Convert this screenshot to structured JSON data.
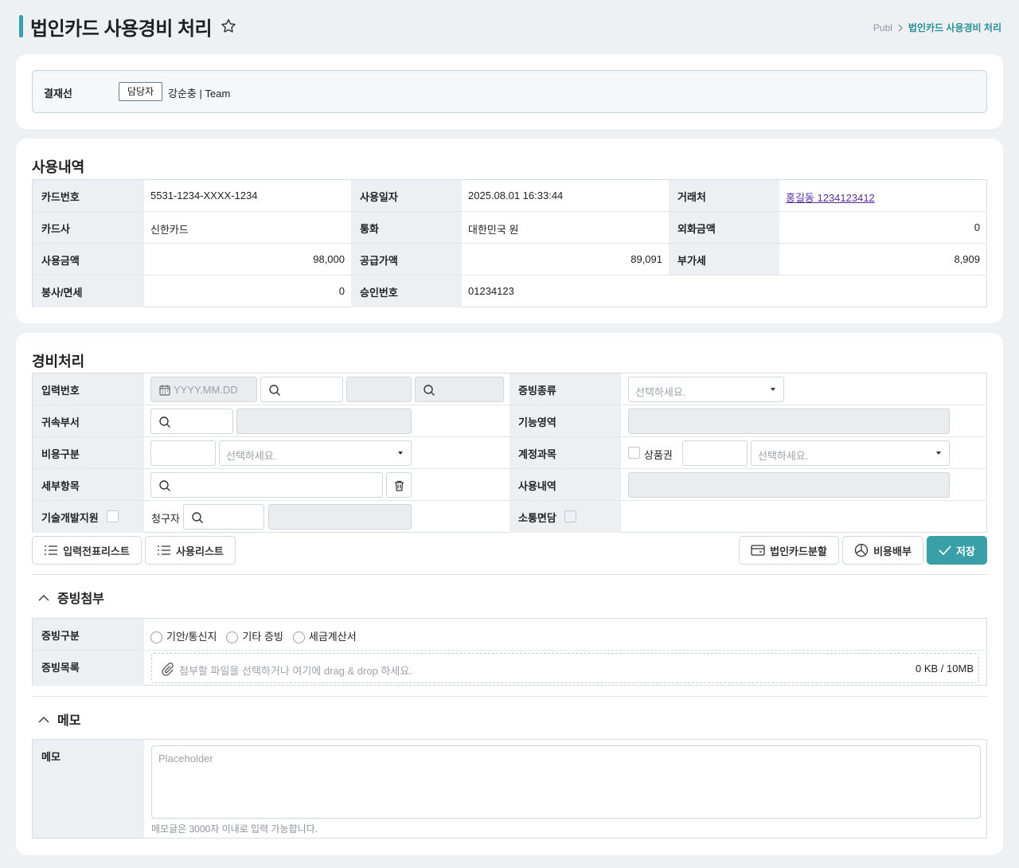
{
  "header": {
    "title": "법인카드 사용경비 처리",
    "breadcrumb_root": "Publ",
    "breadcrumb_current": "법인카드 사용경비 처리"
  },
  "approval": {
    "label": "결재선",
    "role": "담당자",
    "person": "강순충 | Team"
  },
  "usage": {
    "title": "사용내역",
    "fields": {
      "card_no_label": "카드번호",
      "card_no": "5531-1234-XXXX-1234",
      "use_date_label": "사용일자",
      "use_date": "2025.08.01 16:33:44",
      "merchant_label": "거래처",
      "merchant": "홍길동 1234123412",
      "card_co_label": "카드사",
      "card_co": "신한카드",
      "currency_label": "통화",
      "currency": "대한민국 원",
      "foreign_amt_label": "외화금액",
      "foreign_amt": "0",
      "use_amt_label": "사용금액",
      "use_amt": "98,000",
      "supply_label": "공급가액",
      "supply": "89,091",
      "vat_label": "부가세",
      "vat": "8,909",
      "tip_label": "봉사/면세",
      "tip": "0",
      "approval_no_label": "승인번호",
      "approval_no": "01234123"
    }
  },
  "expense": {
    "title": "경비처리",
    "input_no_label": "입력번호",
    "date_placeholder": "YYYY.MM.DD",
    "evidence_type_label": "증빙종류",
    "select_placeholder": "선택하세요.",
    "dept_label": "귀속부서",
    "function_label": "기능영역",
    "cost_type_label": "비용구분",
    "account_label": "계정과목",
    "voucher_label": "상품권",
    "detail_label": "세부항목",
    "usage_label": "사용내역",
    "tech_label": "기술개발지원",
    "claimant_label": "청구자",
    "comm_label": "소통면담"
  },
  "actions": {
    "list1": "입력전표리스트",
    "list2": "사용리스트",
    "split": "법인카드분할",
    "allocate": "비용배부",
    "save": "저장"
  },
  "attachment": {
    "title": "증빙첨부",
    "type_label": "증빙구분",
    "options": [
      "기안/통신지",
      "기타 증빙",
      "세금계산서"
    ],
    "list_label": "증빙목록",
    "drop_text": "첨부할 파일을 선택하거나 여기에 drag & drop 하세요.",
    "size": "0 KB / 10MB"
  },
  "memo": {
    "title": "메모",
    "label": "메모",
    "placeholder": "Placeholder",
    "hint": "메모글은 3000자 이내로 입력 가능합니다."
  },
  "colors": {
    "accent": "#3aa0a8",
    "label_bg": "#edf0f3",
    "disabled_bg": "#e9edf0",
    "link": "#5b2e9b"
  }
}
